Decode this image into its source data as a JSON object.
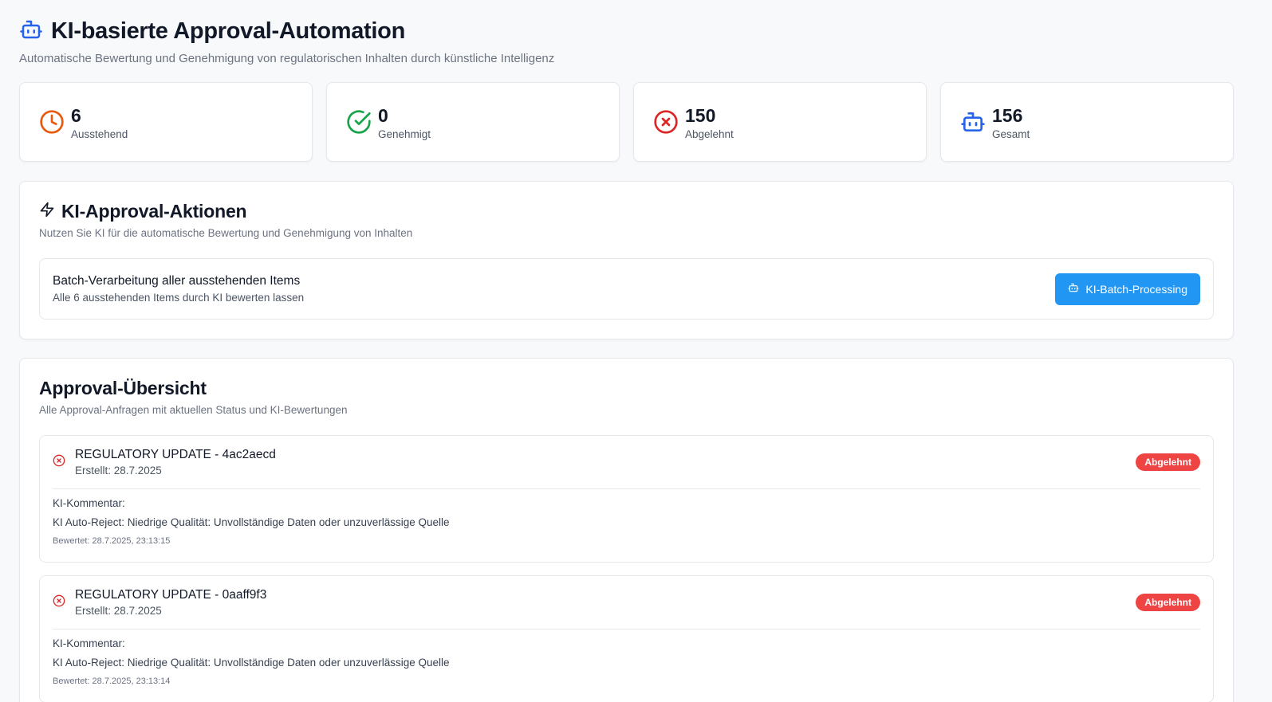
{
  "header": {
    "title": "KI-basierte Approval-Automation",
    "subtitle": "Automatische Bewertung und Genehmigung von regulatorischen Inhalten durch künstliche Intelligenz",
    "icon": "bot-icon"
  },
  "stats": [
    {
      "value": "6",
      "label": "Ausstehend",
      "icon": "clock-icon",
      "color": "#e8590c"
    },
    {
      "value": "0",
      "label": "Genehmigt",
      "icon": "check-circle-icon",
      "color": "#16a34a"
    },
    {
      "value": "150",
      "label": "Abgelehnt",
      "icon": "x-circle-icon",
      "color": "#dc2626"
    },
    {
      "value": "156",
      "label": "Gesamt",
      "icon": "bot-icon",
      "color": "#2563eb"
    }
  ],
  "actions": {
    "title": "KI-Approval-Aktionen",
    "description": "Nutzen Sie KI für die automatische Bewertung und Genehmigung von Inhalten",
    "batch": {
      "title": "Batch-Verarbeitung aller ausstehenden Items",
      "description": "Alle 6 ausstehenden Items durch KI bewerten lassen",
      "button_label": "KI-Batch-Processing"
    }
  },
  "overview": {
    "title": "Approval-Übersicht",
    "description": "Alle Approval-Anfragen mit aktuellen Status und KI-Bewertungen",
    "items": [
      {
        "title": "REGULATORY UPDATE - 4ac2aecd",
        "created": "Erstellt: 28.7.2025",
        "status": "Abgelehnt",
        "comment_label": "KI-Kommentar:",
        "comment": "KI Auto-Reject: Niedrige Qualität: Unvollständige Daten oder unzuverlässige Quelle",
        "rated": "Bewertet: 28.7.2025, 23:13:15"
      },
      {
        "title": "REGULATORY UPDATE - 0aaff9f3",
        "created": "Erstellt: 28.7.2025",
        "status": "Abgelehnt",
        "comment_label": "KI-Kommentar:",
        "comment": "KI Auto-Reject: Niedrige Qualität: Unvollständige Daten oder unzuverlässige Quelle",
        "rated": "Bewertet: 28.7.2025, 23:13:14"
      }
    ]
  },
  "colors": {
    "accent_blue": "#2196f3",
    "reject_red": "#ef4444"
  }
}
